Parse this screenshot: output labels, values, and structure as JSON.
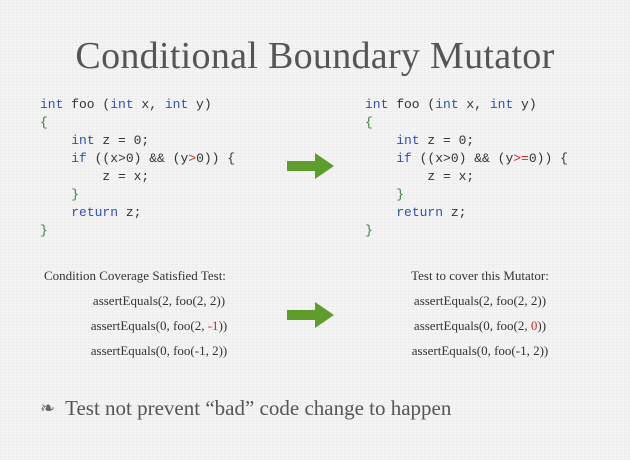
{
  "slide": {
    "title": "Conditional Boundary Mutator"
  },
  "code_left": {
    "l1_kw1": "int",
    "l1_fn": " foo (",
    "l1_kw2": "int",
    "l1_x": " x, ",
    "l1_kw3": "int",
    "l1_y": " y)",
    "l2_brace": "{",
    "l3_indent": "    ",
    "l3_kw": "int",
    "l3_rest": " z = 0;",
    "l4_indent": "    ",
    "l4_kw": "if",
    "l4_a": " ((x>0) && (y",
    "l4_op": ">",
    "l4_b": "0)) {",
    "l5_line": "        z = x;",
    "l6_indent": "    ",
    "l6_brace": "}",
    "l7_indent": "    ",
    "l7_kw": "return",
    "l7_rest": " z;",
    "l8_brace": "}"
  },
  "code_right": {
    "l1_kw1": "int",
    "l1_fn": " foo (",
    "l1_kw2": "int",
    "l1_x": " x, ",
    "l1_kw3": "int",
    "l1_y": " y)",
    "l2_brace": "{",
    "l3_indent": "    ",
    "l3_kw": "int",
    "l3_rest": " z = 0;",
    "l4_indent": "    ",
    "l4_kw": "if",
    "l4_a": " ((x>0) && (y",
    "l4_op": ">=",
    "l4_b": "0)) {",
    "l5_line": "        z = x;",
    "l6_indent": "    ",
    "l6_brace": "}",
    "l7_indent": "    ",
    "l7_kw": "return",
    "l7_rest": " z;",
    "l8_brace": "}"
  },
  "tests_left": {
    "heading": "Condition Coverage Satisfied Test:",
    "t1": "assertEquals(2, foo(2, 2))",
    "t2_pre": "assertEquals(0, foo(2, ",
    "t2_val": "-1",
    "t2_post": "))",
    "t3": "assertEquals(0, foo(-1, 2))"
  },
  "tests_right": {
    "heading": "Test to cover this Mutator:",
    "t1": "assertEquals(2, foo(2, 2))",
    "t2_pre": "assertEquals(0, foo(2, ",
    "t2_val": "0",
    "t2_post": "))",
    "t3": "assertEquals(0, foo(-1, 2))"
  },
  "bullet": {
    "icon": "floral-heart-bullet-icon",
    "text": "Test not prevent “bad” code change to happen"
  },
  "colors": {
    "keyword": "#2d52b5",
    "brace": "#2f8a2f",
    "mutation": "#d62a1e",
    "arrow": "#5e9c2b"
  }
}
